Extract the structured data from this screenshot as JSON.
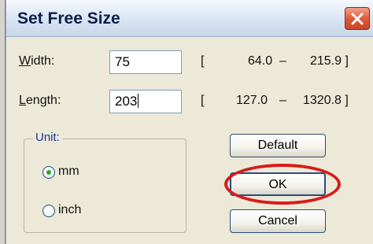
{
  "window": {
    "title": "Set Free Size"
  },
  "fields": {
    "width": {
      "label": "Width:",
      "mnemonic": "W",
      "rest": "idth:",
      "value": "75",
      "range_open": "[",
      "min": "64.0",
      "dash": "–",
      "max": "215.9 ]"
    },
    "length": {
      "label": "Length:",
      "mnemonic": "L",
      "rest": "ength:",
      "value": "203",
      "range_open": "[",
      "min": "127.0",
      "dash": "–",
      "max": "1320.8 ]"
    }
  },
  "unit": {
    "label": "Unit:",
    "options": [
      {
        "label": "mm",
        "selected": true
      },
      {
        "label": "inch",
        "selected": false
      }
    ]
  },
  "buttons": {
    "default": "Default",
    "ok": "OK",
    "cancel": "Cancel"
  },
  "colors": {
    "highlight": "#d81b1b",
    "titlebar": "#dde7f4",
    "close": "#e25c39"
  },
  "icons": {
    "close": "close-icon"
  }
}
